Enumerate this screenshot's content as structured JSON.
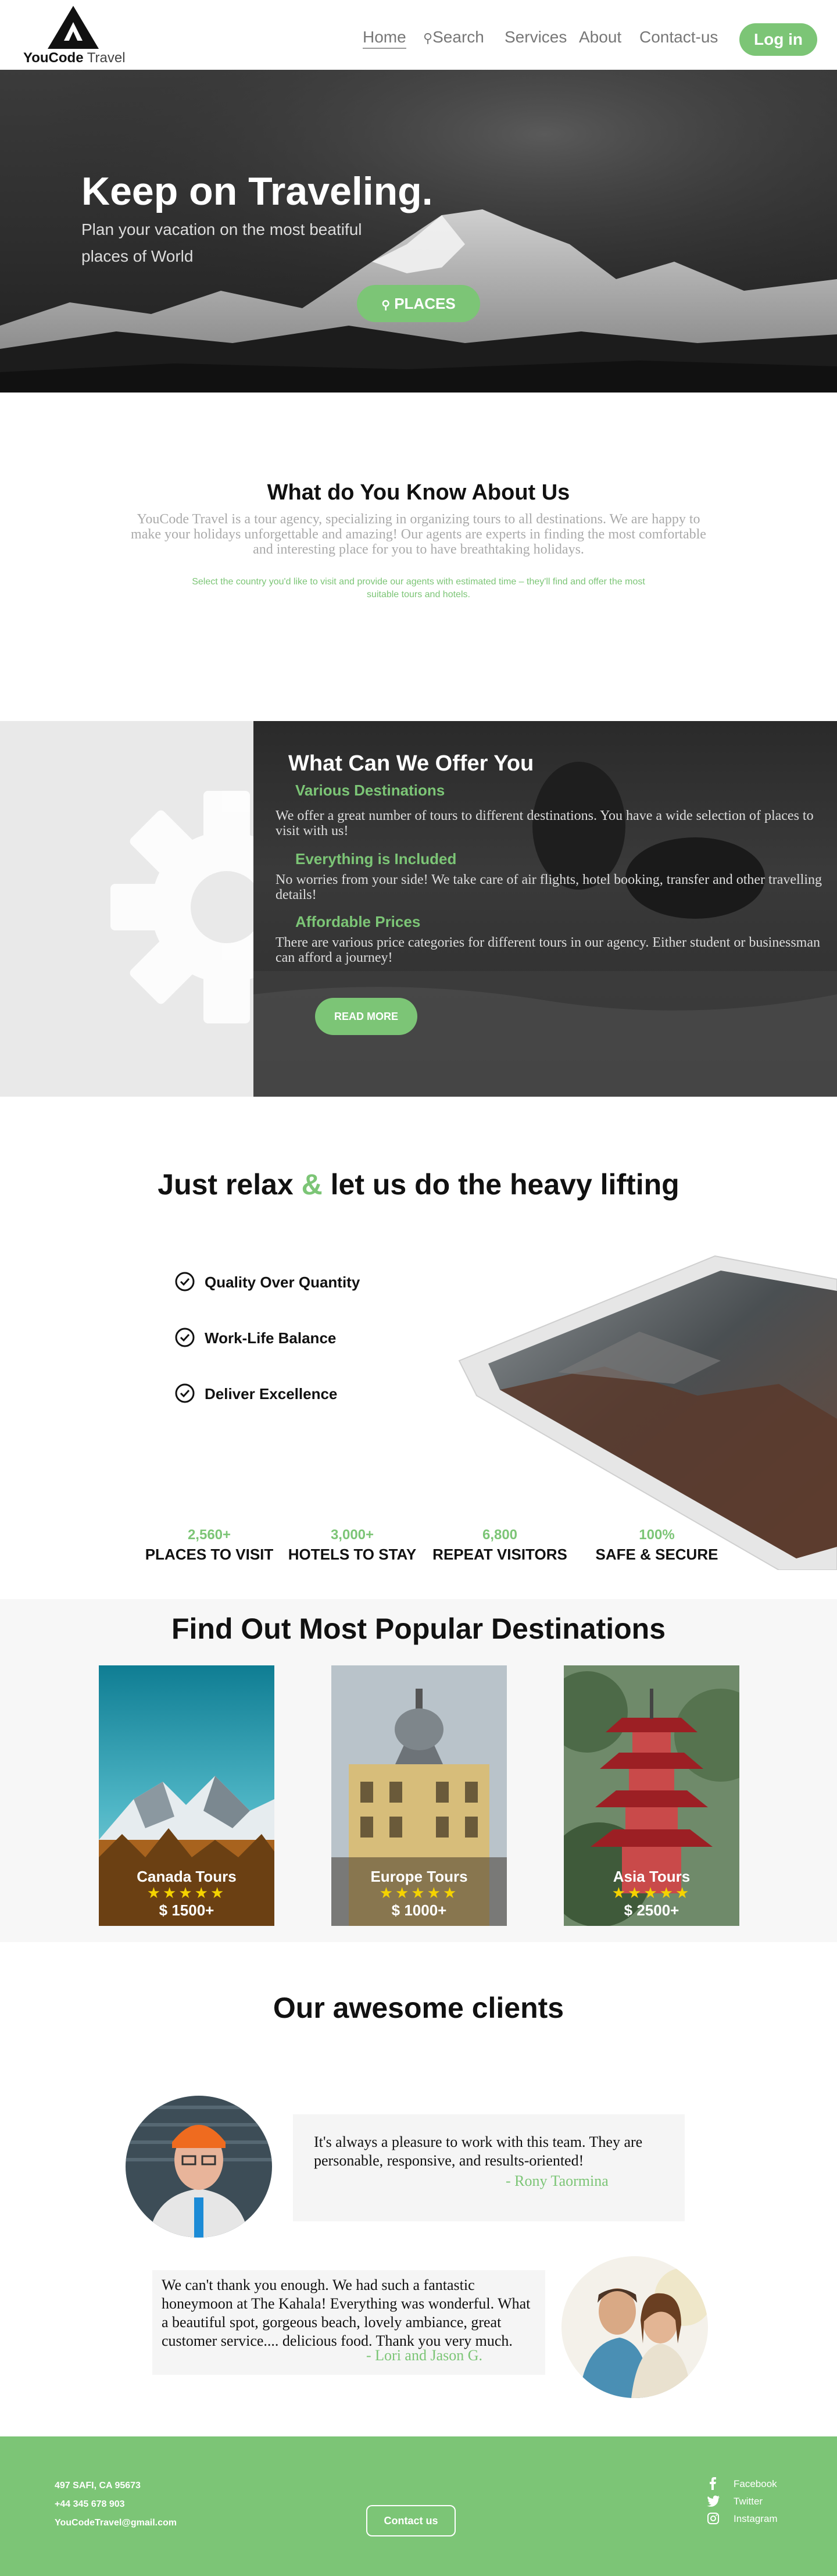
{
  "nav": {
    "brand_bold": "YouCode",
    "brand_light": "Travel",
    "links": [
      "Home",
      "Search",
      "Services",
      "About",
      "Contact-us"
    ],
    "login": "Log in"
  },
  "hero": {
    "title": "Keep on Traveling.",
    "subtitle": "Plan your vacation on the most beatiful places of World",
    "button": "PLACES"
  },
  "about": {
    "title": "What do You Know About Us",
    "body": "YouCode Travel is a tour agency, specializing in organizing tours to all destinations. We are happy to make your holidays unforgettable and amazing! Our agents are experts in finding the most comfortable and interesting place for you to have breathtaking holidays.",
    "note": "Select the country you'd like to visit and provide our agents with estimated time – they'll find and offer the most suitable tours and hotels."
  },
  "offer": {
    "title": "What Can We Offer You",
    "items": [
      {
        "heading": "Various Destinations",
        "text": "We offer a great number of tours to different destinations. You have a wide selection of places to visit with us!"
      },
      {
        "heading": "Everything is Included",
        "text": "No worries from your side! We take care of air flights, hotel booking, transfer and other travelling details!"
      },
      {
        "heading": "Affordable Prices",
        "text": "There are various price categories for different tours in our agency. Either student or businessman can afford a journey!"
      }
    ],
    "button": "READ MORE"
  },
  "relax": {
    "title_a": "Just relax ",
    "title_amp": "&",
    "title_b": " let us do the heavy lifting",
    "checks": [
      "Quality Over Quantity",
      "Work-Life Balance",
      "Deliver Excellence"
    ],
    "stats": [
      {
        "number": "2,560+",
        "label": "PLACES TO VISIT"
      },
      {
        "number": "3,000+",
        "label": "HOTELS TO STAY"
      },
      {
        "number": "6,800",
        "label": "REPEAT VISITORS"
      },
      {
        "number": "100%",
        "label": "SAFE & SECURE"
      }
    ]
  },
  "destinations": {
    "title": "Find Out Most Popular Destinations",
    "cards": [
      {
        "name": "Canada Tours",
        "stars": "★★★★★",
        "price": "$ 1500+"
      },
      {
        "name": "Europe Tours",
        "stars": "★★★★★",
        "price": "$ 1000+"
      },
      {
        "name": "Asia Tours",
        "stars": "★★★★★",
        "price": "$ 2500+"
      }
    ]
  },
  "clients": {
    "title": "Our awesome clients",
    "testimonials": [
      {
        "text": "It's always a pleasure to work with this team. They are personable, responsive, and results-oriented!",
        "author": "- Rony Taormina"
      },
      {
        "text": "We can't thank you enough. We had such a fantastic honeymoon at The Kahala! Everything was wonderful. What a beautiful spot, gorgeous beach, lovely ambiance, great customer service.... delicious food. Thank you very much.",
        "author": "- Lori and Jason G."
      }
    ]
  },
  "footer": {
    "address": "497 SAFI, CA 95673",
    "phone": "+44 345 678 903",
    "email": "YouCodeTravel@gmail.com",
    "contact_button": "Contact us",
    "social": [
      "Facebook",
      "Twitter",
      "Instagram"
    ]
  },
  "colors": {
    "accent": "#7cc576",
    "dark": "#111111",
    "muted": "#aaaaaa"
  }
}
